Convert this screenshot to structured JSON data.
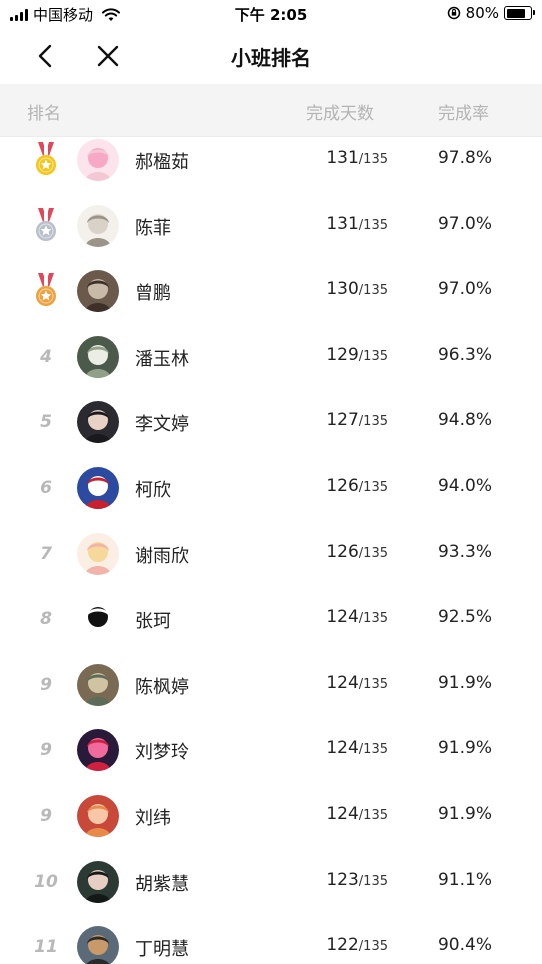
{
  "status_bar": {
    "carrier": "中国移动",
    "time": "下午 2:05",
    "battery": "80%",
    "battery_level": 0.8
  },
  "nav": {
    "title": "小班排名",
    "back_icon": "chevron-left-icon",
    "close_icon": "close-icon"
  },
  "header": {
    "rank": "排名",
    "days": "完成天数",
    "rate": "完成率"
  },
  "colors": {
    "gold": "#f5c518",
    "silver": "#b9c0c9",
    "bronze": "#f0a03c",
    "ribbon": "#e0475a",
    "header_bg": "#f4f4f4",
    "muted": "#b8b8b8"
  },
  "rows": [
    {
      "rank": "",
      "medal": "gold",
      "name": "郝楹茹",
      "days": "131",
      "total": "/135",
      "rate": "97.8%",
      "avatar": "anime-girl-pink"
    },
    {
      "rank": "",
      "medal": "silver",
      "name": "陈菲",
      "days": "131",
      "total": "/135",
      "rate": "97.0%",
      "avatar": "sketch-girl"
    },
    {
      "rank": "",
      "medal": "bronze",
      "name": "曾鹏",
      "days": "130",
      "total": "/135",
      "rate": "97.0%",
      "avatar": "photo-man"
    },
    {
      "rank": "4",
      "medal": "",
      "name": "潘玉林",
      "days": "129",
      "total": "/135",
      "rate": "96.3%",
      "avatar": "anime-white-hair"
    },
    {
      "rank": "5",
      "medal": "",
      "name": "李文婷",
      "days": "127",
      "total": "/135",
      "rate": "94.8%",
      "avatar": "photo-woman"
    },
    {
      "rank": "6",
      "medal": "",
      "name": "柯欣",
      "days": "126",
      "total": "/135",
      "rate": "94.0%",
      "avatar": "anime-red-white"
    },
    {
      "rank": "7",
      "medal": "",
      "name": "谢雨欣",
      "days": "126",
      "total": "/135",
      "rate": "93.3%",
      "avatar": "anime-blonde"
    },
    {
      "rank": "8",
      "medal": "",
      "name": "张珂",
      "days": "124",
      "total": "/135",
      "rate": "92.5%",
      "avatar": "panda-meme"
    },
    {
      "rank": "9",
      "medal": "",
      "name": "陈枫婷",
      "days": "124",
      "total": "/135",
      "rate": "91.9%",
      "avatar": "cats-strip"
    },
    {
      "rank": "9",
      "medal": "",
      "name": "刘梦玲",
      "days": "124",
      "total": "/135",
      "rate": "91.9%",
      "avatar": "anime-pink-red"
    },
    {
      "rank": "9",
      "medal": "",
      "name": "刘纬",
      "days": "124",
      "total": "/135",
      "rate": "91.9%",
      "avatar": "cartoon-girl"
    },
    {
      "rank": "10",
      "medal": "",
      "name": "胡紫慧",
      "days": "123",
      "total": "/135",
      "rate": "91.1%",
      "avatar": "photo-woman-dark"
    },
    {
      "rank": "11",
      "medal": "",
      "name": "丁明慧",
      "days": "122",
      "total": "/135",
      "rate": "90.4%",
      "avatar": "photo-dog"
    }
  ]
}
